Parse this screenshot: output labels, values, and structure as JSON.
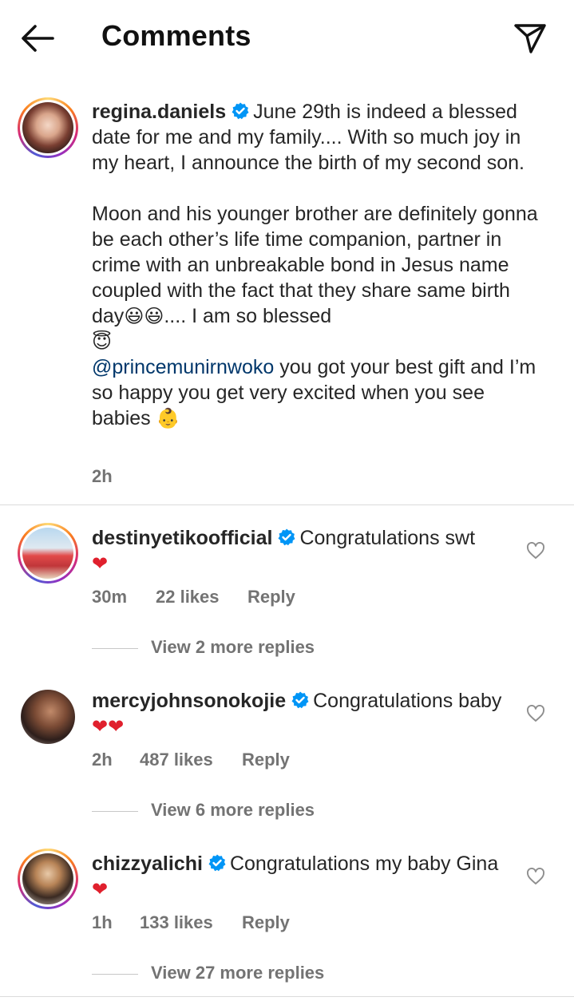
{
  "header": {
    "title": "Comments",
    "back_icon": "arrow-left-icon",
    "share_icon": "paper-plane-icon"
  },
  "caption": {
    "username": "regina.daniels",
    "text_1": "June 29th is indeed a blessed date for me and my family.... With so much joy in my heart, I announce the birth of my second son.",
    "text_2": "Moon and his younger brother are definitely gonna be each other’s life time companion, partner in crime with an unbreakable bond in Jesus name coupled with the fact that they share same birth day",
    "emoji_1": "😃😃",
    "text_3": ".... I am so blessed",
    "emoji_2": "😇",
    "mention": "@princemunirnwoko",
    "text_4": " you got your best gift and I’m so happy you get very excited when you see babies ",
    "emoji_3": "👶",
    "time": "2h"
  },
  "comments": [
    {
      "username": "destinyetikoofficial",
      "text": "Congratulations swt",
      "emoji": "❤",
      "time": "30m",
      "likes": "22 likes",
      "reply": "Reply",
      "view_replies": "View 2 more replies"
    },
    {
      "username": "mercyjohnsonokojie",
      "text": "Congratulations baby",
      "emoji": "❤❤",
      "time": "2h",
      "likes": "487 likes",
      "reply": "Reply",
      "view_replies": "View 6 more replies"
    },
    {
      "username": "chizzyalichi",
      "text": "Congratulations my baby Gina ",
      "emoji": "❤",
      "time": "1h",
      "likes": "133 likes",
      "reply": "Reply",
      "view_replies": "View 27 more replies"
    }
  ],
  "colors": {
    "verified_blue": "#0095f6",
    "mention_blue": "#00376b",
    "meta_gray": "#737373",
    "heart_red": "#e0202d"
  }
}
